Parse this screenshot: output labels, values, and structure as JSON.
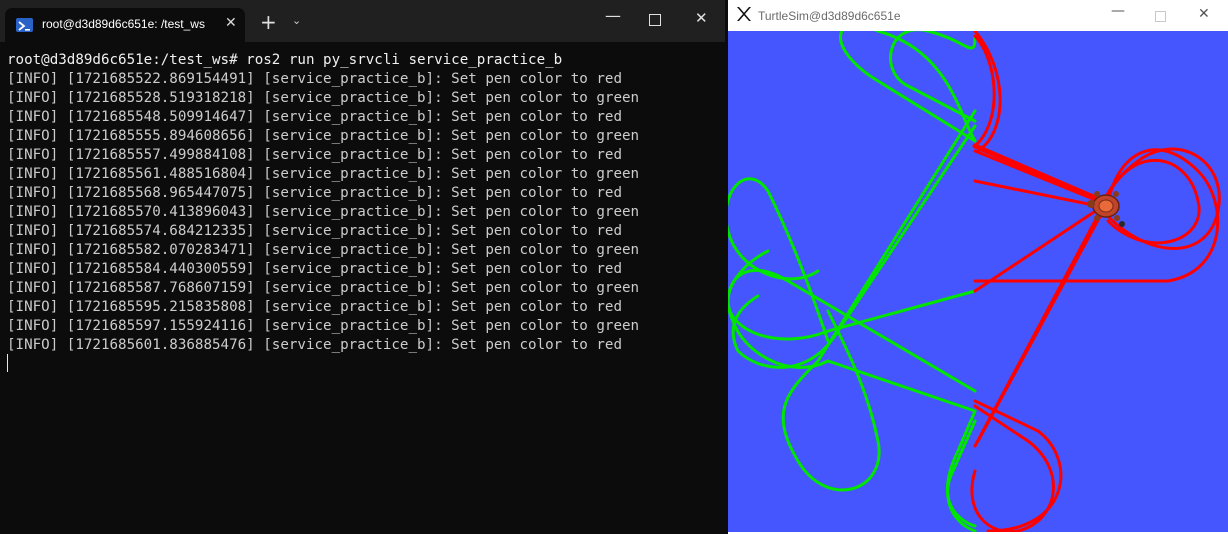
{
  "terminal": {
    "tab_title": "root@d3d89d6c651e: /test_ws",
    "tab_close_glyph": "✕",
    "new_tab_glyph": "+",
    "dropdown_glyph": "⌄",
    "window_buttons": {
      "minimize": "—",
      "close": "✕"
    },
    "command_line": "root@d3d89d6c651e:/test_ws# ros2 run py_srvcli service_practice_b",
    "log_lines": [
      "[INFO] [1721685522.869154491] [service_practice_b]: Set pen color to red",
      "[INFO] [1721685528.519318218] [service_practice_b]: Set pen color to green",
      "[INFO] [1721685548.509914647] [service_practice_b]: Set pen color to red",
      "[INFO] [1721685555.894608656] [service_practice_b]: Set pen color to green",
      "[INFO] [1721685557.499884108] [service_practice_b]: Set pen color to red",
      "[INFO] [1721685561.488516804] [service_practice_b]: Set pen color to green",
      "[INFO] [1721685568.965447075] [service_practice_b]: Set pen color to red",
      "[INFO] [1721685570.413896043] [service_practice_b]: Set pen color to green",
      "[INFO] [1721685574.684212335] [service_practice_b]: Set pen color to red",
      "[INFO] [1721685582.070283471] [service_practice_b]: Set pen color to green",
      "[INFO] [1721685584.440300559] [service_practice_b]: Set pen color to red",
      "[INFO] [1721685587.768607159] [service_practice_b]: Set pen color to green",
      "[INFO] [1721685595.215835808] [service_practice_b]: Set pen color to red",
      "[INFO] [1721685597.155924116] [service_practice_b]: Set pen color to green",
      "[INFO] [1721685601.836885476] [service_practice_b]: Set pen color to red"
    ]
  },
  "turtlesim": {
    "window_title": "TurtleSim@d3d89d6c651e",
    "window_buttons": {
      "minimize": "—",
      "close": "✕"
    },
    "background_color": "#4556ff",
    "pen_colors": {
      "red": "#ff0000",
      "green": "#00e600"
    }
  },
  "icons": {
    "terminal_tab": "powershell-icon",
    "turtlesim_window": "x11-logo-icon",
    "turtle": "turtle-icon"
  }
}
